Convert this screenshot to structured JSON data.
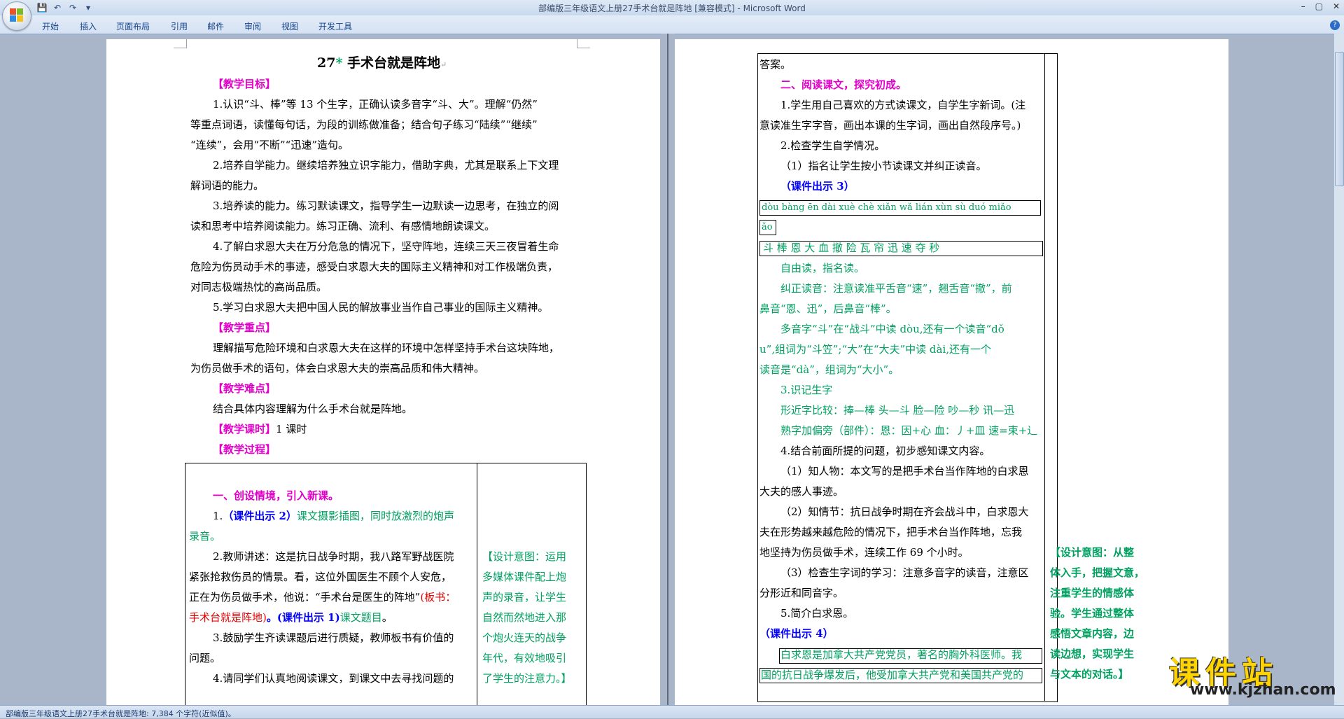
{
  "window": {
    "title": "部编版三年级语文上册27手术台就是阵地 [兼容模式] - Microsoft Word",
    "controls": [
      "–",
      "▢",
      "✕"
    ]
  },
  "quick_access": [
    "save-icon",
    "undo-icon",
    "redo-icon",
    "customize-icon"
  ],
  "ribbon_tabs": [
    "开始",
    "插入",
    "页面布局",
    "引用",
    "邮件",
    "审阅",
    "视图",
    "开发工具"
  ],
  "status": {
    "text": "部编版三年级语文上册27手术台就是阵地: 7,384 个字符(近似值)。"
  },
  "watermark": {
    "text": "课件站",
    "url": "www.kjzhan.com"
  },
  "page1": {
    "title_num": "27",
    "title_star": "*",
    "title_text": " 手术台就是阵地",
    "h_goal": "【教学目标】",
    "goal1_a": "1.认识“斗、棒”等 13 个生字，正确认读多音字“斗、大”。理解“仍然”",
    "goal1_b": "等重点词语，读懂每句话，为段的训练做准备；结合句子练习“陆续”“继续”",
    "goal1_c": "“连续”，会用“不断”“迅速”造句。",
    "goal2_a": "2.培养自学能力。继续培养独立识字能力，借助字典，尤其是联系上下文理",
    "goal2_b": "解词语的能力。",
    "goal3_a": "3.培养读的能力。练习默读课文，指导学生一边默读一边思考，在独立的阅",
    "goal3_b": "读和思考中培养阅读能力。练习正确、流利、有感情地朗读课文。",
    "goal4_a": "4.了解白求恩大夫在万分危急的情况下，坚守阵地，连续三天三夜冒着生命",
    "goal4_b": "危险为伤员动手术的事迹，感受白求恩大夫的国际主义精神和对工作极端负责，",
    "goal4_c": "对同志极端热忱的高尚品质。",
    "goal5": "5.学习白求恩大夫把中国人民的解放事业当作自己事业的国际主义精神。",
    "h_key": "【教学重点】",
    "key_a": "理解描写危险环境和白求恩大夫在这样的环境中怎样坚持手术台这块阵地，",
    "key_b": "为伤员做手术的语句，体会白求恩大夫的崇高品质和伟大精神。",
    "h_diff": "【教学难点】",
    "diff": "结合具体内容理解为什么手术台就是阵地。",
    "h_time": "【教学课时】",
    "time": "1 课时",
    "h_proc": "【教学过程】",
    "s1_head": "一、创设情境，引入新课。",
    "s1_1_num": "1.",
    "s1_1_blue": "（课件出示 2）",
    "s1_1_green_a": "课文摄影插图，同时放激烈的炮声",
    "s1_1_green_b": "录音。",
    "s1_2_a": "2.教师讲述：这是抗日战争时期，我八路军野战医院",
    "s1_2_b": "紧张抢救伤员的情景。看，这位外国医生不顾个人安危，",
    "s1_2_c": "正在为伤员做手术，他说：“手术台是医生的阵地”",
    "s1_2_red1": "(板书：",
    "s1_2_red2": "手术台就是阵地)",
    "s1_2_blue": "。(课件出示 1)",
    "s1_2_green": "课文题目",
    "s1_2_end": "。",
    "s1_3_a": "3.鼓励学生齐读课题后进行质疑，教师板书有价值的",
    "s1_3_b": "问题。",
    "s1_4": "4.请同学们认真地阅读课文，到课文中去寻找问题的",
    "design1": [
      "【设计意图：运用",
      "多媒体课件配上炮",
      "声的录音，让学生",
      "自然而然地进入那",
      "个炮火连天的战争",
      "年代，有效地吸引",
      "了学生的注意力。】"
    ]
  },
  "page2": {
    "l1": "答案。",
    "s2_head": "二、阅读课文，探究初成。",
    "l2a": "1.学生用自己喜欢的方式读课文，自学生字新词。(注",
    "l2b": "意读准生字字音，画出本课的生字词，画出自然段序号。)",
    "l3": "2.检查学生自学情况。",
    "l4": "（1）指名让学生按小节读课文并纠正读音。",
    "l5": "（课件出示 3）",
    "pinyin_a": "dòu bàng ēn dài xuè chè xiǎn wǎ lián xùn sù duó miǎo",
    "pinyin_b": "ǎo",
    "chars": "斗  棒  恩 大  血  撤  险  瓦  帘  迅  速 夺  秒",
    "l6": "自由读，指名读。",
    "l7a": "纠正读音：注意读准平舌音“速”，翘舌音“撤”，前",
    "l7b": "鼻音“恩、迅”，后鼻音“棒”。",
    "l8a": "多音字“斗”在“战斗”中读 dòu,还有一个读音“dǒ",
    "l8b": "u”,组词为“斗笠”;“大”在“大夫”中读 dài,还有一个",
    "l8c": "读音是“dà”，组词为“大小”。",
    "l9": "3.识记生字",
    "l10": "形近字比较：捧—棒   头—斗  脸—险  吵—秒  讯—迅",
    "l11": "熟字加偏旁（部件）：恩：因+心  血：丿+皿  速=束+辶",
    "l12": "4.结合前面所提的问题，初步感知课文内容。",
    "l13a": "（1）知人物：本文写的是把手术台当作阵地的白求恩",
    "l13b": "大夫的感人事迹。",
    "l14a": "（2）知情节：抗日战争时期在齐会战斗中，白求恩大",
    "l14b": "夫在形势越来越危险的情况下，把手术台当作阵地，忘我",
    "l14c": "地坚持为伤员做手术，连续工作 69 个小时。",
    "l15a": "（3）检查生字词的学习：注意多音字的读音，注意区",
    "l15b": "分形近和同音字。",
    "l16": "5.简介白求恩。",
    "l17": "（课件出示 4）",
    "l18a": "白求恩是加拿大共产党党员，著名的胸外科医师。我",
    "l18b": "国的抗日战争爆发后，他受加拿大共产党和美国共产党的",
    "design2": [
      "【设计意图：从整",
      "体入手，把握文意，",
      "注重学生的情感体",
      "验。学生通过整体",
      "感悟文章内容，边",
      "读边想，实现学生",
      "与文本的对话。】"
    ]
  },
  "para_mark": "↵"
}
